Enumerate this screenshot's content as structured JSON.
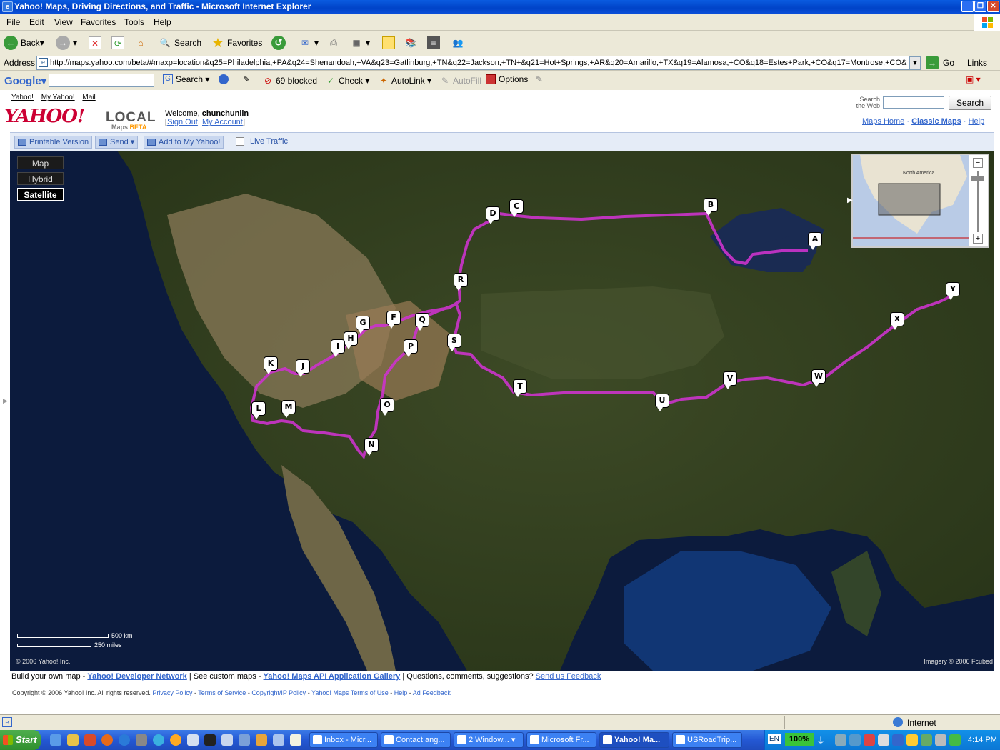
{
  "window": {
    "title": "Yahoo! Maps, Driving Directions, and Traffic - Microsoft Internet Explorer"
  },
  "menu": [
    "File",
    "Edit",
    "View",
    "Favorites",
    "Tools",
    "Help"
  ],
  "toolbar": {
    "back": "Back",
    "search": "Search",
    "favorites": "Favorites"
  },
  "address": {
    "label": "Address",
    "url": "http://maps.yahoo.com/beta/#maxp=location&q25=Philadelphia,+PA&q24=Shenandoah,+VA&q23=Gatlinburg,+TN&q22=Jackson,+TN+&q21=Hot+Springs,+AR&q20=Amarillo,+TX&q19=Alamosa,+CO&q18=Estes+Park,+CO&q17=Montrose,+CO&",
    "go": "Go",
    "links": "Links"
  },
  "googlebar": {
    "logo": "Google",
    "search": "Search",
    "blocked": "69 blocked",
    "check": "Check",
    "autolink": "AutoLink",
    "autofill": "AutoFill",
    "options": "Options"
  },
  "yahoo": {
    "links": [
      "Yahoo!",
      "My Yahoo!",
      "Mail"
    ],
    "logo": "YAHOO!",
    "local": "LOCAL",
    "maps": "Maps",
    "beta": "BETA",
    "welcome": "Welcome,",
    "user": "chunchunlin",
    "sign_out": "Sign Out",
    "my_account": "My Account",
    "search_web_label": "Search the Web",
    "search_button": "Search",
    "top_links": [
      "Maps Home",
      "Classic Maps",
      "Help"
    ]
  },
  "actions": {
    "printable": "Printable Version",
    "send": "Send",
    "add": "Add to My Yahoo!",
    "traffic": "Live Traffic"
  },
  "map": {
    "types": [
      "Map",
      "Hybrid",
      "Satellite"
    ],
    "selected_type": "Satellite",
    "minimap_label": "North America",
    "scale_km": "500 km",
    "scale_mi": "250 miles",
    "copyright_left": "© 2006 Yahoo! Inc.",
    "copyright_right": "Imagery © 2006 Fcubed",
    "route_color": "#cc33cc",
    "markers": [
      "A",
      "B",
      "C",
      "D",
      "F",
      "G",
      "H",
      "I",
      "J",
      "K",
      "L",
      "M",
      "N",
      "O",
      "P",
      "Q",
      "R",
      "S",
      "T",
      "U",
      "V",
      "W",
      "X",
      "Y"
    ]
  },
  "footer": {
    "build": "Build your own map -",
    "ydn": "Yahoo! Developer Network",
    "custom": "| See custom maps -",
    "gallery": "Yahoo! Maps API Application Gallery",
    "questions": "| Questions, comments, suggestions?",
    "feedback": "Send us Feedback",
    "copyright": "Copyright © 2006 Yahoo! Inc. All rights reserved.",
    "links": [
      "Privacy Policy",
      "Terms of Service",
      "Copyright/IP Policy",
      "Yahoo! Maps Terms of Use",
      "Help",
      "Ad Feedback"
    ]
  },
  "status": {
    "zone": "Internet"
  },
  "taskbar": {
    "start": "Start",
    "tasks": [
      "Inbox - Micr...",
      "Contact ang...",
      "2 Window...",
      "Microsoft Fr...",
      "Yahoo! Ma...",
      "USRoadTrip..."
    ],
    "active_task": "Yahoo! Ma...",
    "lang": "EN",
    "battery": "100%",
    "clock": "4:14 PM"
  }
}
